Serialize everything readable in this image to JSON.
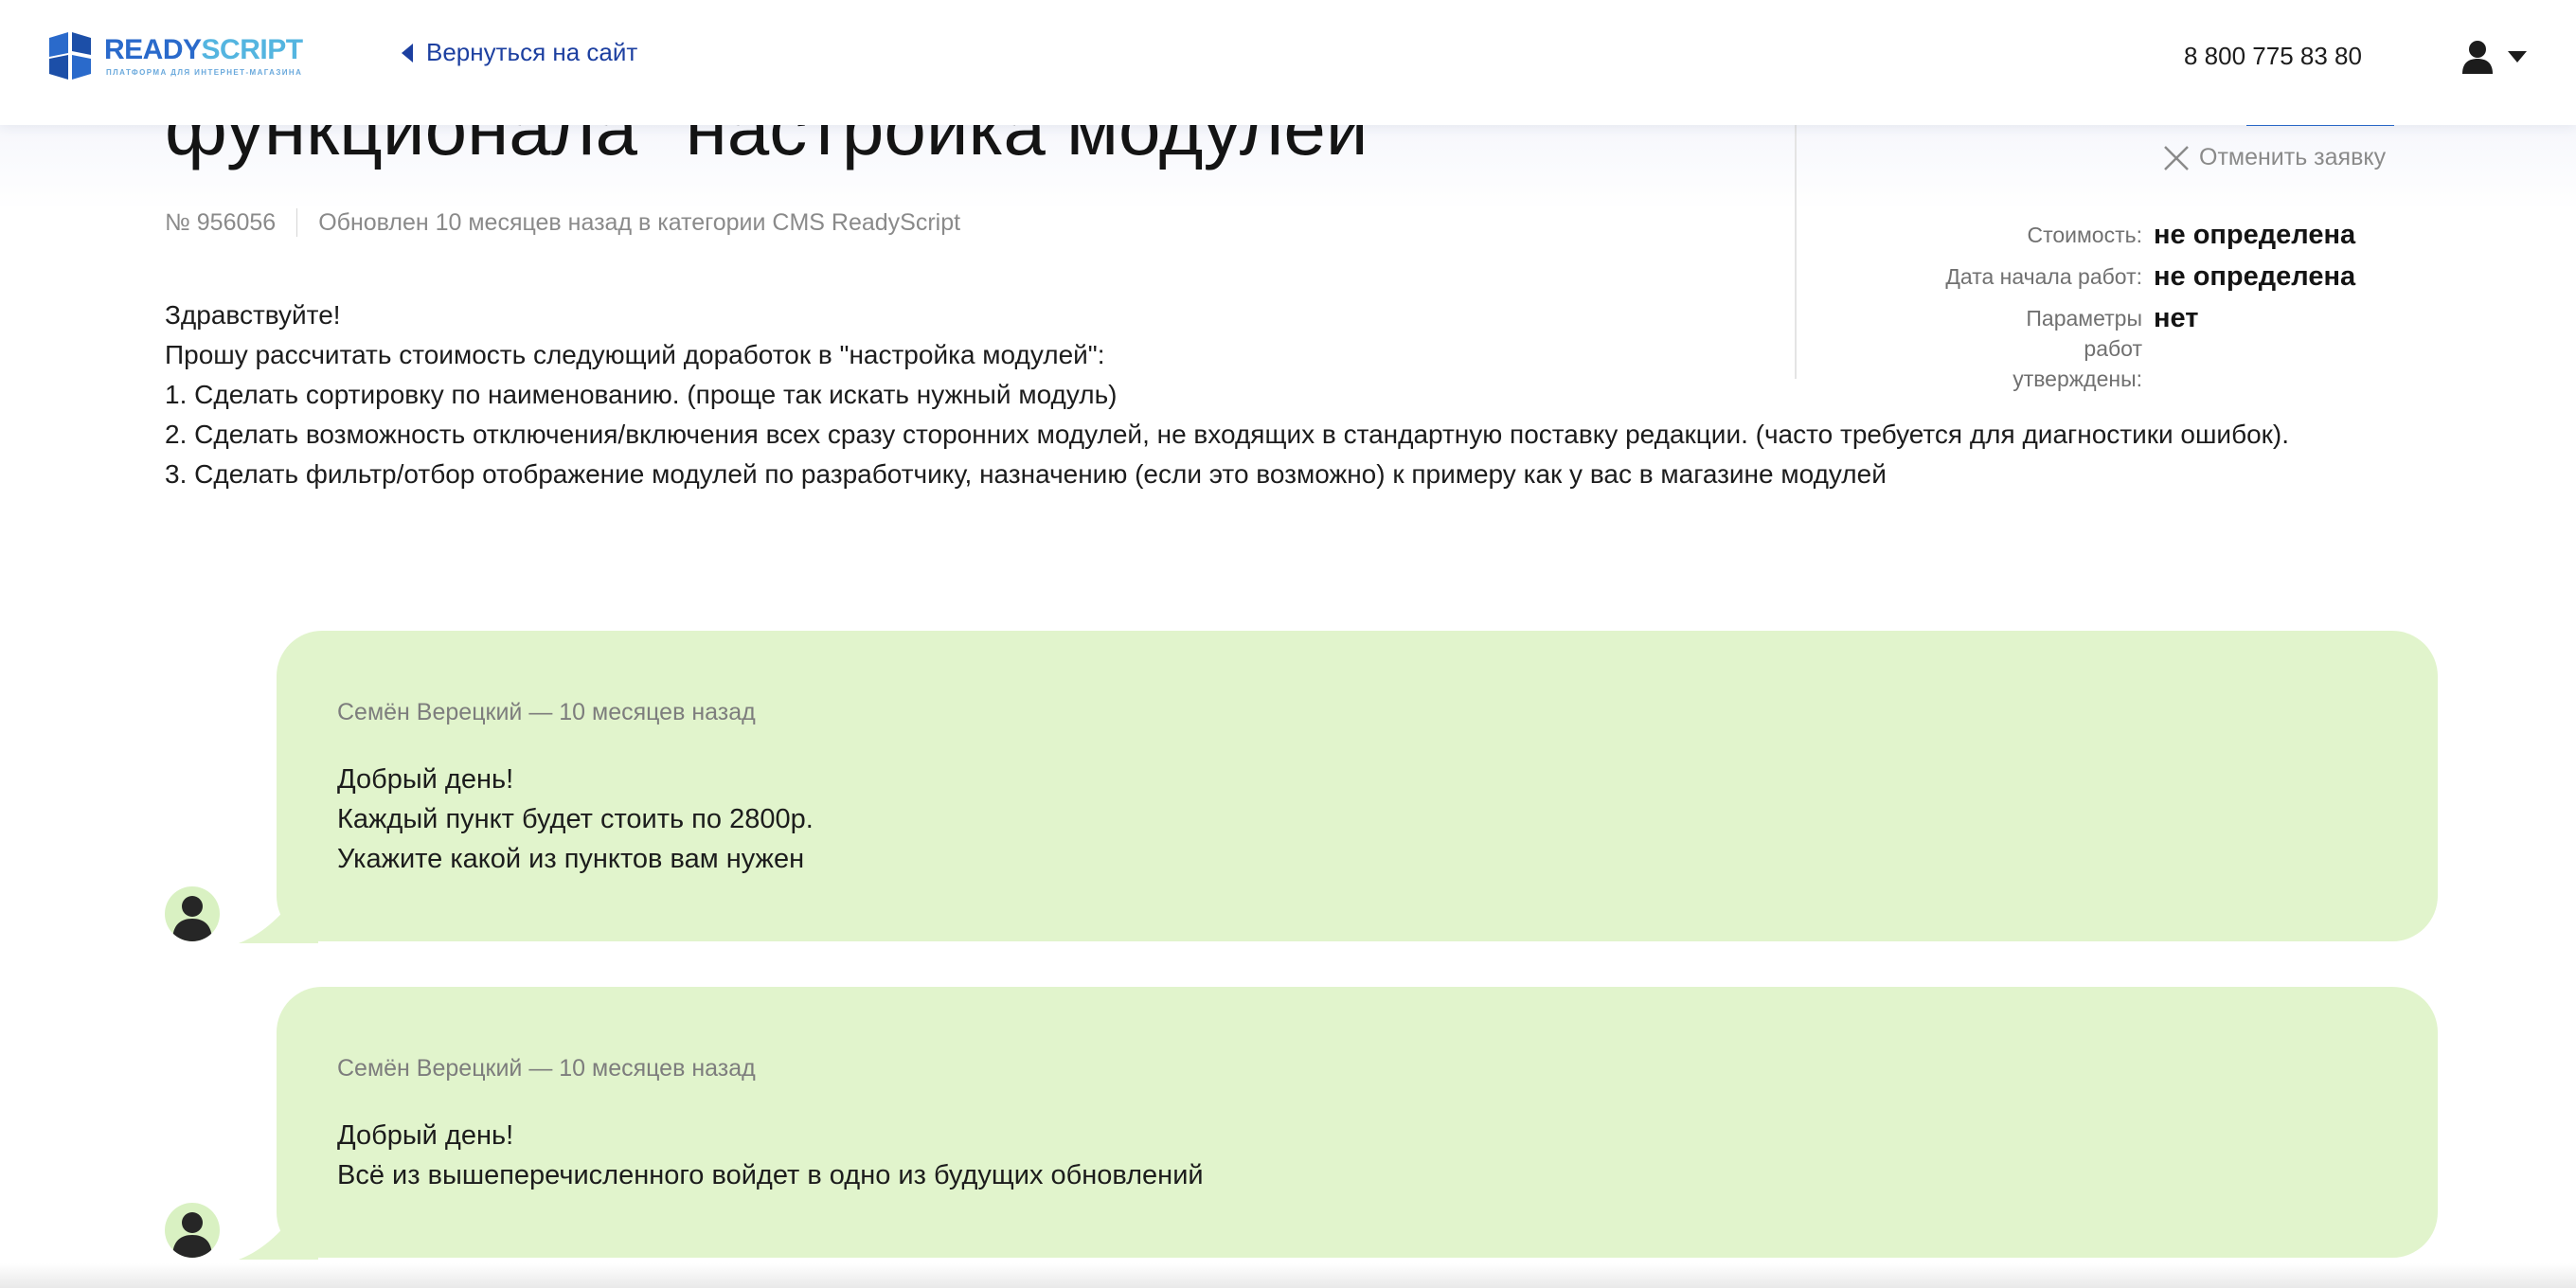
{
  "header": {
    "logo": {
      "word_main": "READY",
      "word_tail": "SCRIPT",
      "tagline": "ПЛАТФОРМА ДЛЯ ИНТЕРНЕТ-МАГАЗИНА"
    },
    "back_link": "Вернуться на сайт",
    "phone": "8 800 775 83 80",
    "icons": {
      "back": "triangle-left-icon",
      "user": "user-icon",
      "menu": "caret-down-icon"
    }
  },
  "request": {
    "title": "функционала \"настройка модулей\"",
    "number": "№ 956056",
    "updated": "Обновлен 10 месяцев назад в категории CMS ReadyScript",
    "body_lines": [
      "Здравствуйте!",
      "Прошу рассчитать стоимость следующий доработок в \"настройка модулей\":",
      "1. Сделать сортировку по наименованию. (проще так искать нужный модуль)",
      "2. Сделать возможность отключения/включения всех сразу сторонних модулей, не входящих в стандартную поставку редакции. (часто требуется для диагностики ошибок).",
      "3. Сделать фильтр/отбор отображение модулей по разработчику, назначению (если это возможно) к примеру как у вас в магазине модулей"
    ]
  },
  "sidebar": {
    "cancel_label": "Отменить заявку",
    "params": [
      {
        "label": "Стоимость:",
        "value": "не определена"
      },
      {
        "label": "Дата начала работ:",
        "value": "не определена"
      },
      {
        "label": "Параметры работ утверждены:",
        "value": "нет"
      }
    ]
  },
  "comments": [
    {
      "author": "Семён Верецкий — 10 месяцев назад",
      "lines": [
        "Добрый день!",
        "Каждый пункт будет стоить по 2800р.",
        "Укажите какой из пунктов вам нужен"
      ]
    },
    {
      "author": "Семён Верецкий — 10 месяцев назад",
      "lines": [
        "Добрый день!",
        "Всё из вышеперечисленного войдет в одно из будущих обновлений"
      ]
    }
  ],
  "colors": {
    "accent": "#1c3fa0",
    "brand": "#2a6acb",
    "bubble": "#e1f4cc",
    "muted": "#8a8a8a"
  }
}
